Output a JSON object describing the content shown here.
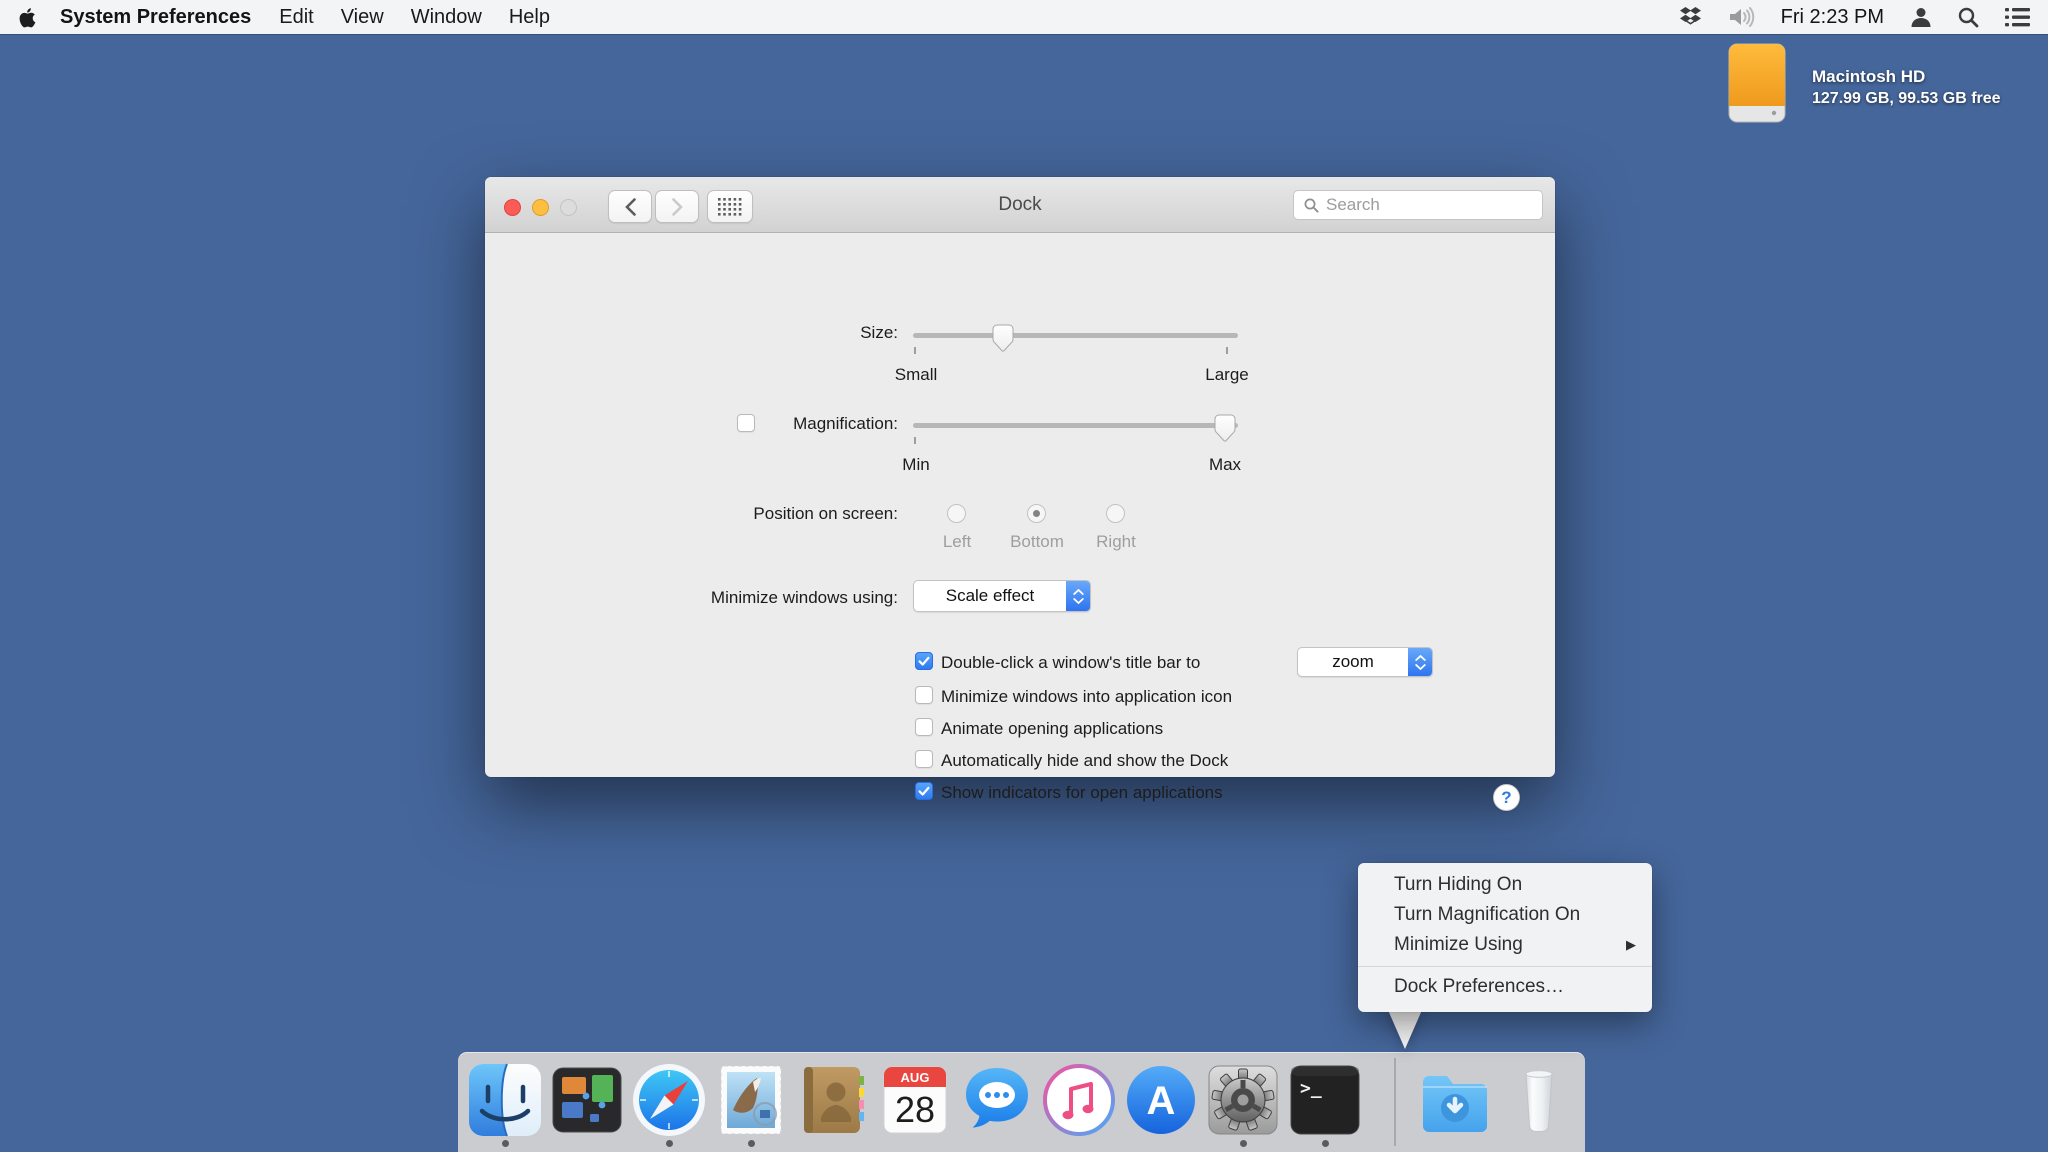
{
  "menu_bar": {
    "app_name": "System Preferences",
    "menus": [
      "Edit",
      "View",
      "Window",
      "Help"
    ],
    "clock": "Fri 2:23 PM"
  },
  "desktop_icon": {
    "name": "Macintosh HD",
    "detail": "127.99 GB, 99.53 GB free"
  },
  "window": {
    "title": "Dock",
    "search_placeholder": "Search",
    "size_row": {
      "label": "Size:",
      "min_label": "Small",
      "max_label": "Large",
      "value_percent": 28
    },
    "magnification_row": {
      "label": "Magnification:",
      "checked": false,
      "min_label": "Min",
      "max_label": "Max",
      "value_percent": 96
    },
    "position_row": {
      "label": "Position on screen:",
      "options": [
        "Left",
        "Bottom",
        "Right"
      ],
      "selected": "Bottom"
    },
    "minimize_row": {
      "label": "Minimize windows using:",
      "value": "Scale effect"
    },
    "checkbox_rows": [
      {
        "label": "Double-click a window's title bar to",
        "checked": true,
        "value": "zoom"
      },
      {
        "label": "Minimize windows into application icon",
        "checked": false
      },
      {
        "label": "Animate opening applications",
        "checked": false
      },
      {
        "label": "Automatically hide and show the Dock",
        "checked": false
      },
      {
        "label": "Show indicators for open applications",
        "checked": true
      }
    ],
    "help_label": "?"
  },
  "dock_menu": {
    "items": [
      "Turn Hiding On",
      "Turn Magnification On",
      "Minimize Using"
    ],
    "submenu_arrow": "▶",
    "preferences_item": "Dock Preferences…"
  },
  "dock": {
    "apps": [
      "finder",
      "mission-control",
      "safari",
      "mail",
      "contacts",
      "calendar",
      "messages",
      "itunes",
      "app-store",
      "system-preferences",
      "terminal",
      "downloads",
      "trash"
    ],
    "running": [
      "finder",
      "safari",
      "mail",
      "system-preferences",
      "terminal"
    ],
    "calendar_month": "AUG",
    "calendar_day": "28",
    "appstore_glyph": "A",
    "terminal_glyph": ">_"
  },
  "colors": {
    "desktop": "#45669b",
    "accent_blue": "#2e7bf0",
    "menubar_bg": "#f7f7f7",
    "dock_bg": "#d2d2d2"
  }
}
